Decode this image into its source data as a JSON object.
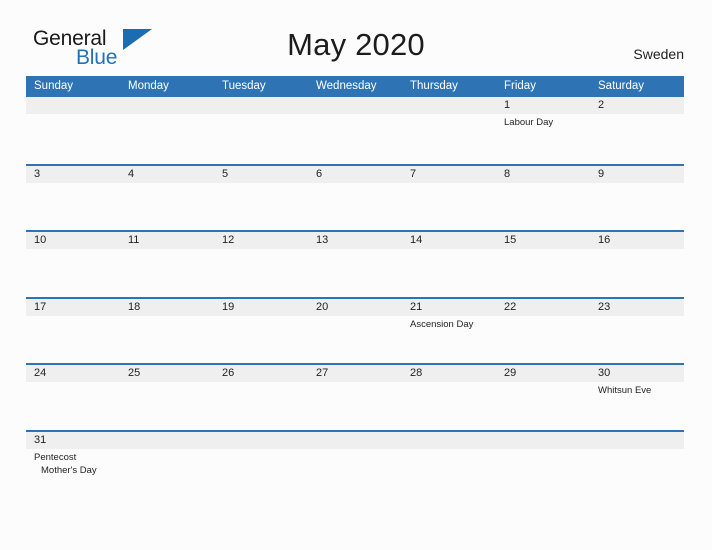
{
  "brand": {
    "word_one": "General",
    "word_two": "Blue",
    "flag_icon": "brand-triangle-icon",
    "accent_color": "#1b6cb3"
  },
  "header": {
    "title": "May 2020",
    "country": "Sweden"
  },
  "colors": {
    "header_blue": "#2e74b5",
    "row_band_gray": "#efefef",
    "page_background": "#fcfcfd",
    "text": "#1f1f1f"
  },
  "calendar": {
    "weekdays": [
      "Sunday",
      "Monday",
      "Tuesday",
      "Wednesday",
      "Thursday",
      "Friday",
      "Saturday"
    ],
    "weeks": [
      {
        "days": [
          {
            "number": "",
            "events": []
          },
          {
            "number": "",
            "events": []
          },
          {
            "number": "",
            "events": []
          },
          {
            "number": "",
            "events": []
          },
          {
            "number": "",
            "events": []
          },
          {
            "number": "1",
            "events": [
              "Labour Day"
            ]
          },
          {
            "number": "2",
            "events": []
          }
        ]
      },
      {
        "days": [
          {
            "number": "3",
            "events": []
          },
          {
            "number": "4",
            "events": []
          },
          {
            "number": "5",
            "events": []
          },
          {
            "number": "6",
            "events": []
          },
          {
            "number": "7",
            "events": []
          },
          {
            "number": "8",
            "events": []
          },
          {
            "number": "9",
            "events": []
          }
        ]
      },
      {
        "days": [
          {
            "number": "10",
            "events": []
          },
          {
            "number": "11",
            "events": []
          },
          {
            "number": "12",
            "events": []
          },
          {
            "number": "13",
            "events": []
          },
          {
            "number": "14",
            "events": []
          },
          {
            "number": "15",
            "events": []
          },
          {
            "number": "16",
            "events": []
          }
        ]
      },
      {
        "days": [
          {
            "number": "17",
            "events": []
          },
          {
            "number": "18",
            "events": []
          },
          {
            "number": "19",
            "events": []
          },
          {
            "number": "20",
            "events": []
          },
          {
            "number": "21",
            "events": [
              "Ascension Day"
            ]
          },
          {
            "number": "22",
            "events": []
          },
          {
            "number": "23",
            "events": []
          }
        ]
      },
      {
        "days": [
          {
            "number": "24",
            "events": []
          },
          {
            "number": "25",
            "events": []
          },
          {
            "number": "26",
            "events": []
          },
          {
            "number": "27",
            "events": []
          },
          {
            "number": "28",
            "events": []
          },
          {
            "number": "29",
            "events": []
          },
          {
            "number": "30",
            "events": [
              "Whitsun Eve"
            ]
          }
        ]
      },
      {
        "days": [
          {
            "number": "31",
            "events": [
              "Pentecost",
              "Mother's Day"
            ]
          },
          {
            "number": "",
            "events": []
          },
          {
            "number": "",
            "events": []
          },
          {
            "number": "",
            "events": []
          },
          {
            "number": "",
            "events": []
          },
          {
            "number": "",
            "events": []
          },
          {
            "number": "",
            "events": []
          }
        ]
      }
    ]
  }
}
